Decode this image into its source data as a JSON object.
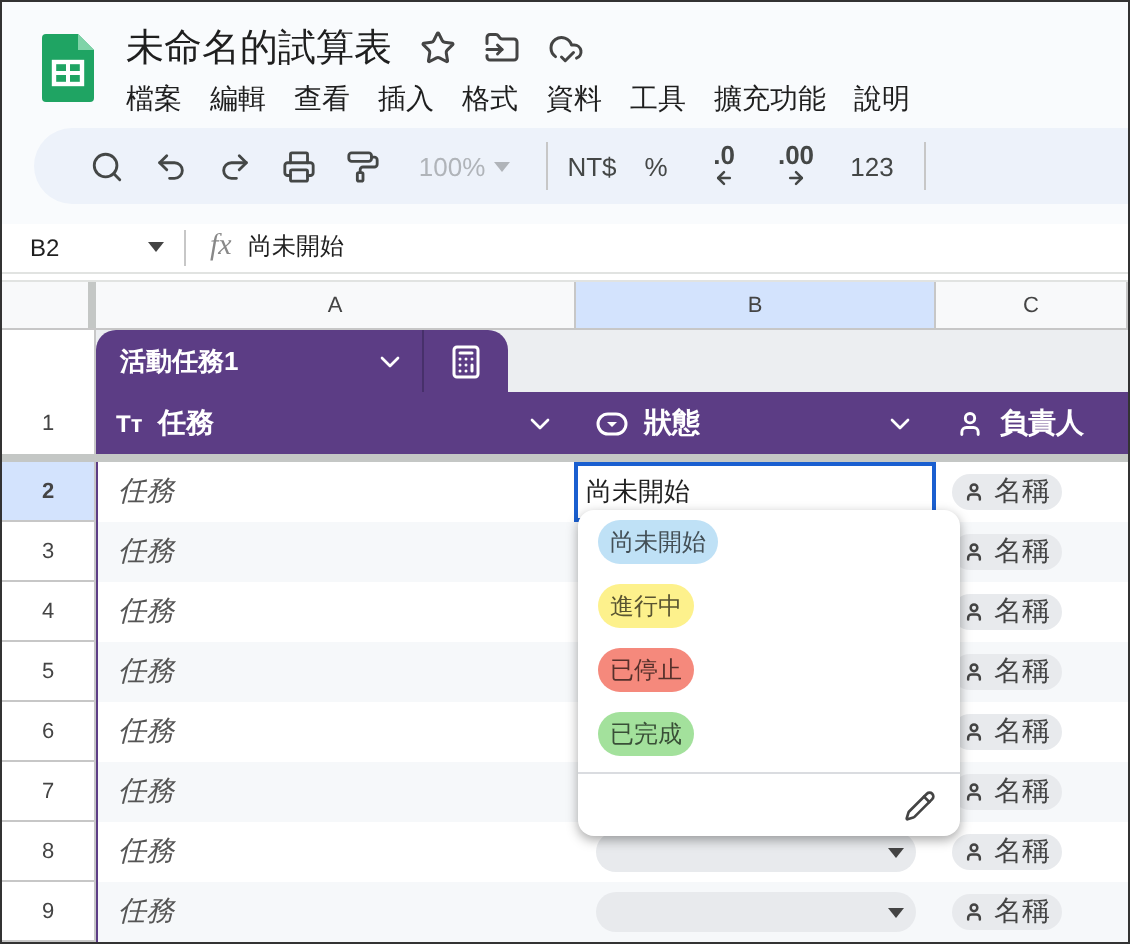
{
  "document": {
    "title": "未命名的試算表"
  },
  "menu": [
    "檔案",
    "編輯",
    "查看",
    "插入",
    "格式",
    "資料",
    "工具",
    "擴充功能",
    "說明"
  ],
  "toolbar": {
    "zoom": "100%",
    "currency": "NT$",
    "percent": "%",
    "decrease_decimal": ".0",
    "increase_decimal": ".00",
    "number_format": "123"
  },
  "formula_bar": {
    "cell": "B2",
    "fx": "fx",
    "value": "尚未開始"
  },
  "columns": [
    {
      "label": "A",
      "selected": false
    },
    {
      "label": "B",
      "selected": true
    },
    {
      "label": "C",
      "selected": false
    }
  ],
  "table": {
    "name": "活動任務1",
    "header_row": "1",
    "columns": [
      {
        "kind": "text",
        "type_mark": "Tт",
        "name": "任務"
      },
      {
        "kind": "dropdown",
        "name": "狀態"
      },
      {
        "kind": "person",
        "name": "負責人"
      }
    ],
    "rows": [
      {
        "number": "2",
        "selected": true,
        "task": "任務",
        "status": "尚未開始",
        "person": "名稱"
      },
      {
        "number": "3",
        "selected": false,
        "task": "任務",
        "person": "名稱"
      },
      {
        "number": "4",
        "selected": false,
        "task": "任務",
        "person": "名稱"
      },
      {
        "number": "5",
        "selected": false,
        "task": "任務",
        "person": "名稱"
      },
      {
        "number": "6",
        "selected": false,
        "task": "任務",
        "person": "名稱"
      },
      {
        "number": "7",
        "selected": false,
        "task": "任務",
        "person": "名稱"
      },
      {
        "number": "8",
        "selected": false,
        "task": "任務",
        "status_chip": true,
        "person": "名稱"
      },
      {
        "number": "9",
        "selected": false,
        "task": "任務",
        "status_chip": true,
        "person": "名稱"
      }
    ]
  },
  "dropdown": {
    "options": [
      {
        "label": "尚未開始",
        "color": "#bfe1f6"
      },
      {
        "label": "進行中",
        "color": "#fdf18c"
      },
      {
        "label": "已停止",
        "color": "#f5897c"
      },
      {
        "label": "已完成",
        "color": "#a3e19c"
      }
    ]
  }
}
